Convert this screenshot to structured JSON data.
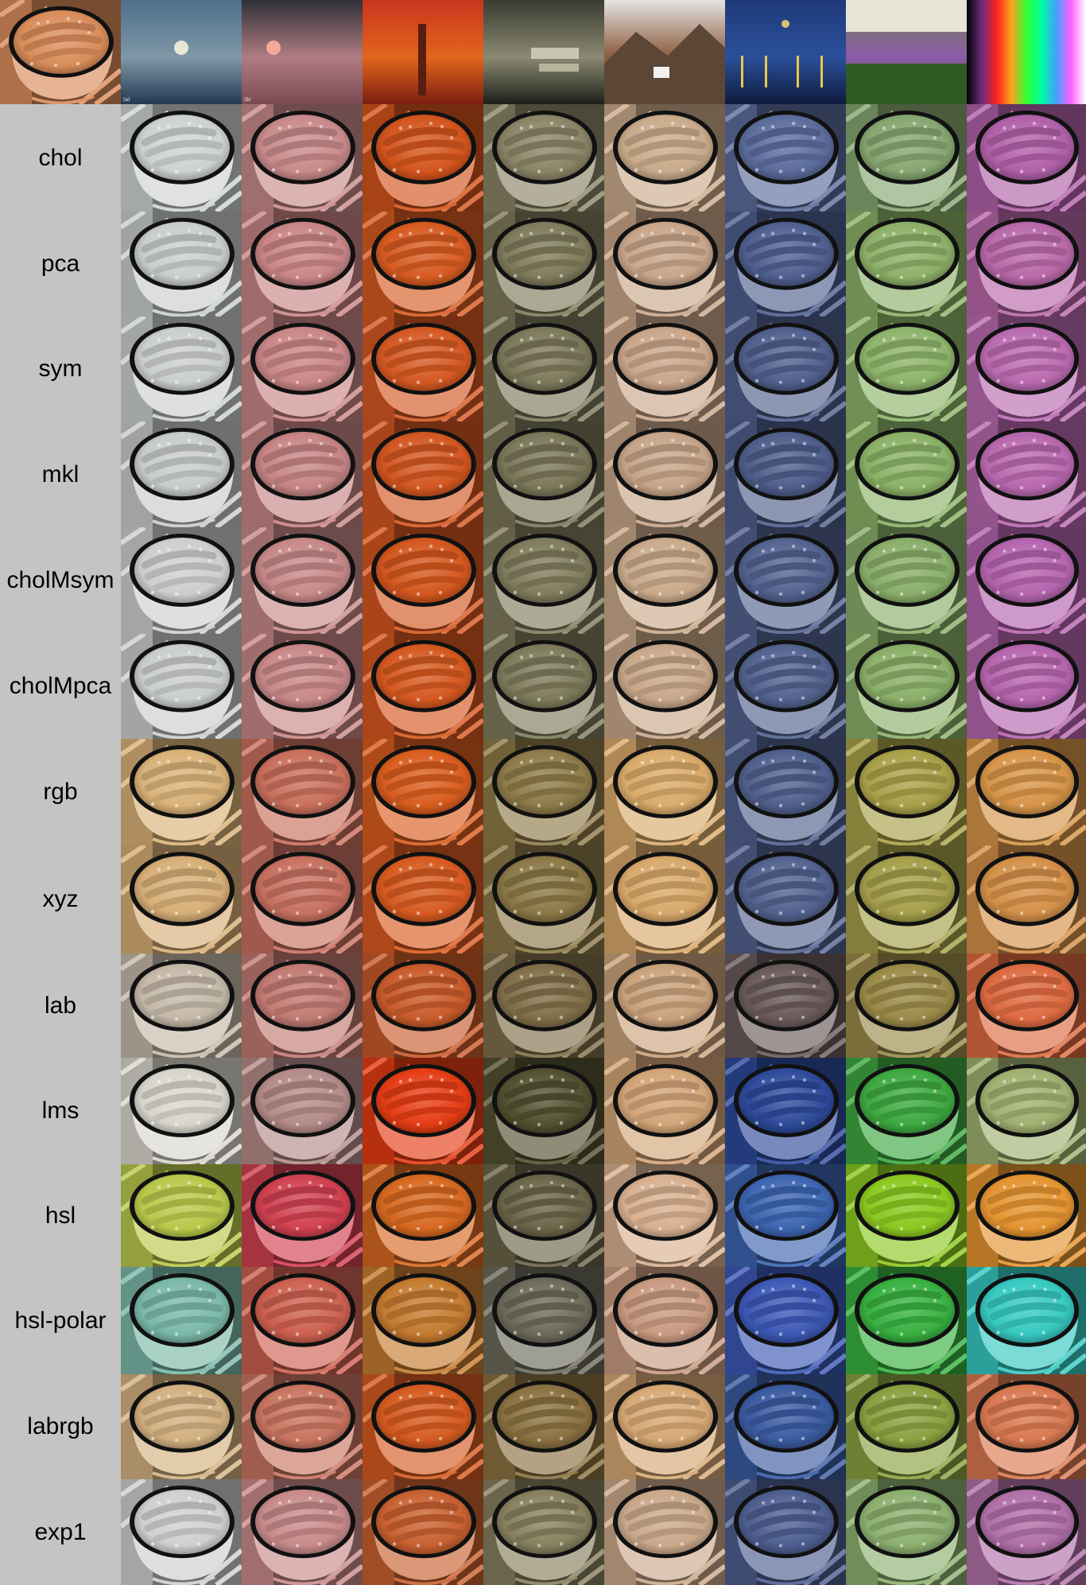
{
  "figure": {
    "content_image": {
      "name": "boiling pot of sausages",
      "icon": "pot-icon"
    },
    "style_images": [
      {
        "name": "sea-sunset",
        "mark": "(a)",
        "top": "#4d6f8a",
        "mid": "#7f98a8",
        "bot": "#223a52",
        "sun": "#f5f0d8"
      },
      {
        "name": "pink-sunset",
        "mark": "(b)",
        "top": "#2e3036",
        "mid": "#b07c82",
        "bot": "#7a4a52",
        "sun": "#ffb0a0"
      },
      {
        "name": "autumn-trees",
        "mark": "",
        "top": "#c8351e",
        "mid": "#e2651c",
        "bot": "#7b1f10",
        "sun": ""
      },
      {
        "name": "house-in-forest",
        "mark": "",
        "top": "#3a3b32",
        "mid": "#8b8a72",
        "bot": "#1d1f19",
        "sun": ""
      },
      {
        "name": "mountain-cottage",
        "mark": "",
        "top": "#e4e4e2",
        "mid": "#8c5a3c",
        "bot": "#a56a3e",
        "sun": ""
      },
      {
        "name": "starry-night-river",
        "mark": "",
        "top": "#1f3a7a",
        "mid": "#2b4f9a",
        "bot": "#0f1b3e",
        "sun": "#e8d76a"
      },
      {
        "name": "cottage-garden",
        "mark": "",
        "top": "#6f8a4b",
        "mid": "#8b5aa8",
        "bot": "#3f6b2a",
        "sun": ""
      },
      {
        "name": "color-spectrum",
        "mark": "",
        "top": "#000000",
        "mid": "#00ff66",
        "bot": "#ffffff",
        "sun": ""
      }
    ],
    "methods": [
      {
        "label": "chol",
        "tints": [
          "#cdd2d0",
          "#c88a8a",
          "#d2541c",
          "#8a8466",
          "#c9aa8a",
          "#5b6c9c",
          "#86a670",
          "#b060a8"
        ]
      },
      {
        "label": "pca",
        "tints": [
          "#c9ceca",
          "#c98585",
          "#d65a20",
          "#7e7a5a",
          "#c8a58a",
          "#4f5f8f",
          "#8cb068",
          "#b868a8"
        ]
      },
      {
        "label": "sym",
        "tints": [
          "#cbcfcb",
          "#c98686",
          "#d45822",
          "#7c785a",
          "#caa68a",
          "#505f8c",
          "#8db46a",
          "#ba6ab0"
        ]
      },
      {
        "label": "mkl",
        "tints": [
          "#c8ccc8",
          "#c68484",
          "#d25620",
          "#7a7658",
          "#c6a488",
          "#4e5d8a",
          "#8ab266",
          "#b868ae"
        ]
      },
      {
        "label": "cholMsym",
        "tints": [
          "#cccfcc",
          "#c78888",
          "#d3561e",
          "#7f7b5c",
          "#c9a98a",
          "#53638f",
          "#89ae6a",
          "#b464ae"
        ]
      },
      {
        "label": "cholMpca",
        "tints": [
          "#cacecb",
          "#c88787",
          "#d4581f",
          "#7d7a5b",
          "#c8a789",
          "#52628e",
          "#8aaf68",
          "#b565ad"
        ]
      },
      {
        "label": "rgb",
        "tints": [
          "#d9b278",
          "#c86f5c",
          "#d85c1e",
          "#8d7a48",
          "#d9aa6a",
          "#50608c",
          "#a8a048",
          "#d69448"
        ]
      },
      {
        "label": "xyz",
        "tints": [
          "#d6ae76",
          "#c77060",
          "#d75a20",
          "#8b7847",
          "#d8a86a",
          "#52628e",
          "#a49e4a",
          "#d49048"
        ]
      },
      {
        "label": "lab",
        "tints": [
          "#c4b8a8",
          "#c07a72",
          "#c85a2a",
          "#806e48",
          "#c9a27c",
          "#6a5a5a",
          "#9a8a48",
          "#dc6a40"
        ]
      },
      {
        "label": "lms",
        "tints": [
          "#d8d6cc",
          "#b48b88",
          "#e43c14",
          "#525030",
          "#d2a478",
          "#2d4a9a",
          "#3ea840",
          "#a0b070"
        ]
      },
      {
        "label": "hsl",
        "tints": [
          "#b8c84a",
          "#d04050",
          "#d66820",
          "#6a6448",
          "#d8b090",
          "#3c64b0",
          "#8ac820",
          "#e49430"
        ]
      },
      {
        "label": "hsl-polar",
        "tints": [
          "#7ab8a8",
          "#cc6050",
          "#c47a30",
          "#6c6a5a",
          "#c89a80",
          "#3c58b4",
          "#38b040",
          "#36c8c0"
        ]
      },
      {
        "label": "labrgb",
        "tints": [
          "#d2b080",
          "#c87460",
          "#d45a20",
          "#8a7040",
          "#d6a874",
          "#3a5aa0",
          "#8aa040",
          "#d87850"
        ]
      },
      {
        "label": "exp1",
        "tints": [
          "#cdd0cc",
          "#c88a8a",
          "#c86030",
          "#86805e",
          "#caa88a",
          "#4d5e90",
          "#8cb070",
          "#b070a8"
        ]
      }
    ]
  }
}
